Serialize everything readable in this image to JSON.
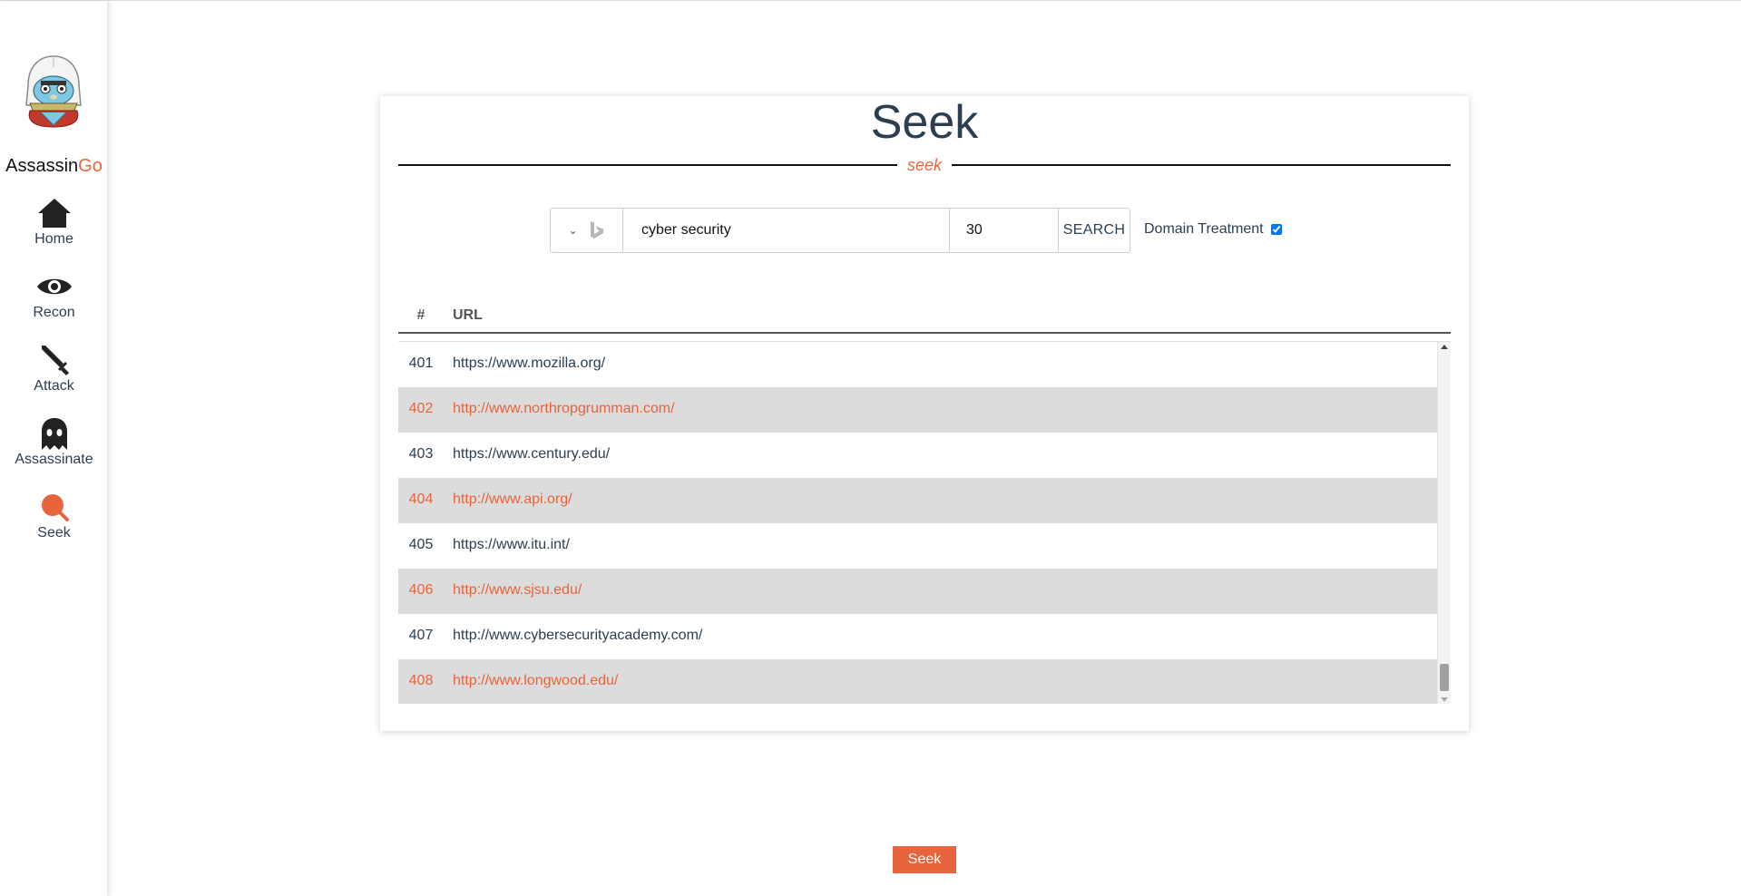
{
  "brand": {
    "name_main": "Assassin",
    "name_accent": "Go"
  },
  "sidebar": {
    "items": [
      {
        "label": "Home",
        "icon": "home-icon"
      },
      {
        "label": "Recon",
        "icon": "eye-icon"
      },
      {
        "label": "Attack",
        "icon": "sword-icon"
      },
      {
        "label": "Assassinate",
        "icon": "ghost-icon"
      },
      {
        "label": "Seek",
        "icon": "search-icon",
        "active": true
      }
    ]
  },
  "page": {
    "title": "Seek",
    "subtitle": "seek"
  },
  "search": {
    "engine_icon": "bing-icon",
    "query": "cyber security",
    "count": "30",
    "button_label": "SEARCH",
    "domain_treatment_label": "Domain Treatment",
    "domain_treatment_checked": true
  },
  "table": {
    "headers": {
      "num": "#",
      "url": "URL"
    },
    "rows": [
      {
        "num": "401",
        "url": "https://www.mozilla.org/"
      },
      {
        "num": "402",
        "url": "http://www.northropgrumman.com/"
      },
      {
        "num": "403",
        "url": "https://www.century.edu/"
      },
      {
        "num": "404",
        "url": "http://www.api.org/"
      },
      {
        "num": "405",
        "url": "https://www.itu.int/"
      },
      {
        "num": "406",
        "url": "http://www.sjsu.edu/"
      },
      {
        "num": "407",
        "url": "http://www.cybersecurityacademy.com/"
      },
      {
        "num": "408",
        "url": "http://www.longwood.edu/"
      }
    ]
  },
  "footer": {
    "seek_button_label": "Seek"
  },
  "colors": {
    "accent": "#e8643c",
    "text": "#2c3e50",
    "row_alt": "#dcdcdc"
  }
}
